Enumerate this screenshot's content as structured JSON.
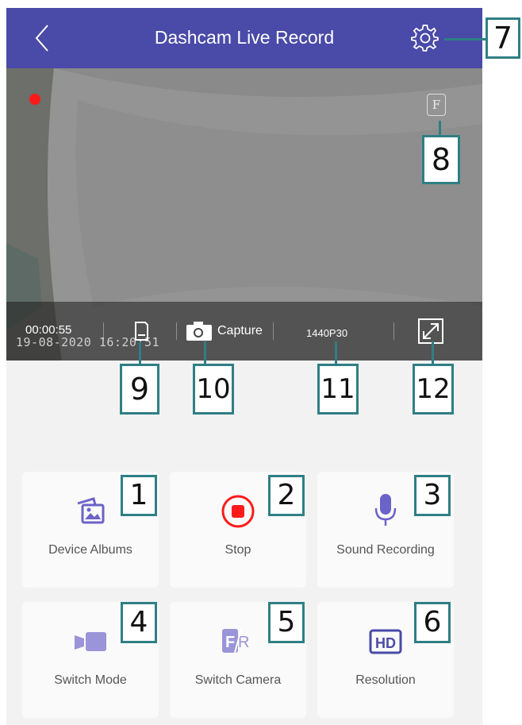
{
  "header": {
    "title": "Dashcam Live Record",
    "back_icon": "chevron-left-icon",
    "settings_icon": "gear-icon"
  },
  "video": {
    "camera_badge": "F",
    "elapsed": "00:00:55",
    "timestamp_overlay": "19-08-2020 16:20:51",
    "capture_label": "Capture",
    "resolution_label": "1440P30"
  },
  "tiles": [
    {
      "label": "Device Albums",
      "icon": "album-icon"
    },
    {
      "label": "Stop",
      "icon": "stop-record-icon"
    },
    {
      "label": "Sound Recording",
      "icon": "microphone-icon"
    },
    {
      "label": "Switch Mode",
      "icon": "video-camera-icon"
    },
    {
      "label": "Switch Camera",
      "icon": "front-rear-icon"
    },
    {
      "label": "Resolution",
      "icon": "hd-icon"
    }
  ],
  "callouts": [
    "1",
    "2",
    "3",
    "4",
    "5",
    "6",
    "7",
    "8",
    "9",
    "10",
    "11",
    "12"
  ],
  "colors": {
    "header": "#4a4aa8",
    "accent": "#6c63c9",
    "record_red": "#ff1a1a",
    "callout_border": "#2f7f84"
  }
}
